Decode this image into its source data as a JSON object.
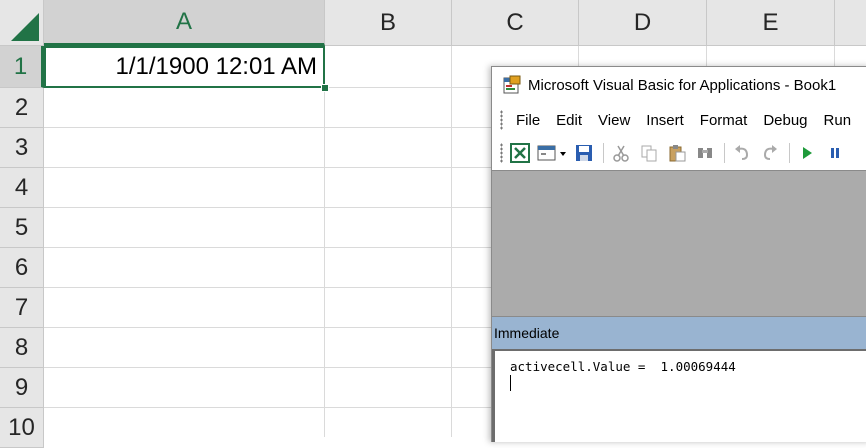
{
  "spreadsheet": {
    "columns": [
      "A",
      "B",
      "C",
      "D",
      "E"
    ],
    "rows": [
      "1",
      "2",
      "3",
      "4",
      "5",
      "6",
      "7",
      "8",
      "9",
      "10"
    ],
    "active_column": "A",
    "active_row": "1",
    "cell_a1_value": "1/1/1900 12:01 AM"
  },
  "vba": {
    "title": "Microsoft Visual Basic for Applications - Book1",
    "menu": [
      "File",
      "Edit",
      "View",
      "Insert",
      "Format",
      "Debug",
      "Run"
    ],
    "toolbar_icons": [
      "excel-view-icon",
      "insert-userform-icon",
      "save-icon",
      "cut-icon",
      "copy-icon",
      "paste-icon",
      "find-icon",
      "undo-icon",
      "redo-icon",
      "run-icon",
      "break-icon"
    ],
    "immediate_title": "Immediate",
    "immediate_line": "activecell.Value =  1.00069444"
  },
  "colors": {
    "excel_green": "#217346",
    "header_gray": "#e6e6e6",
    "immediate_title_bar": "#99b4d1",
    "vba_gray_area": "#ababab"
  }
}
